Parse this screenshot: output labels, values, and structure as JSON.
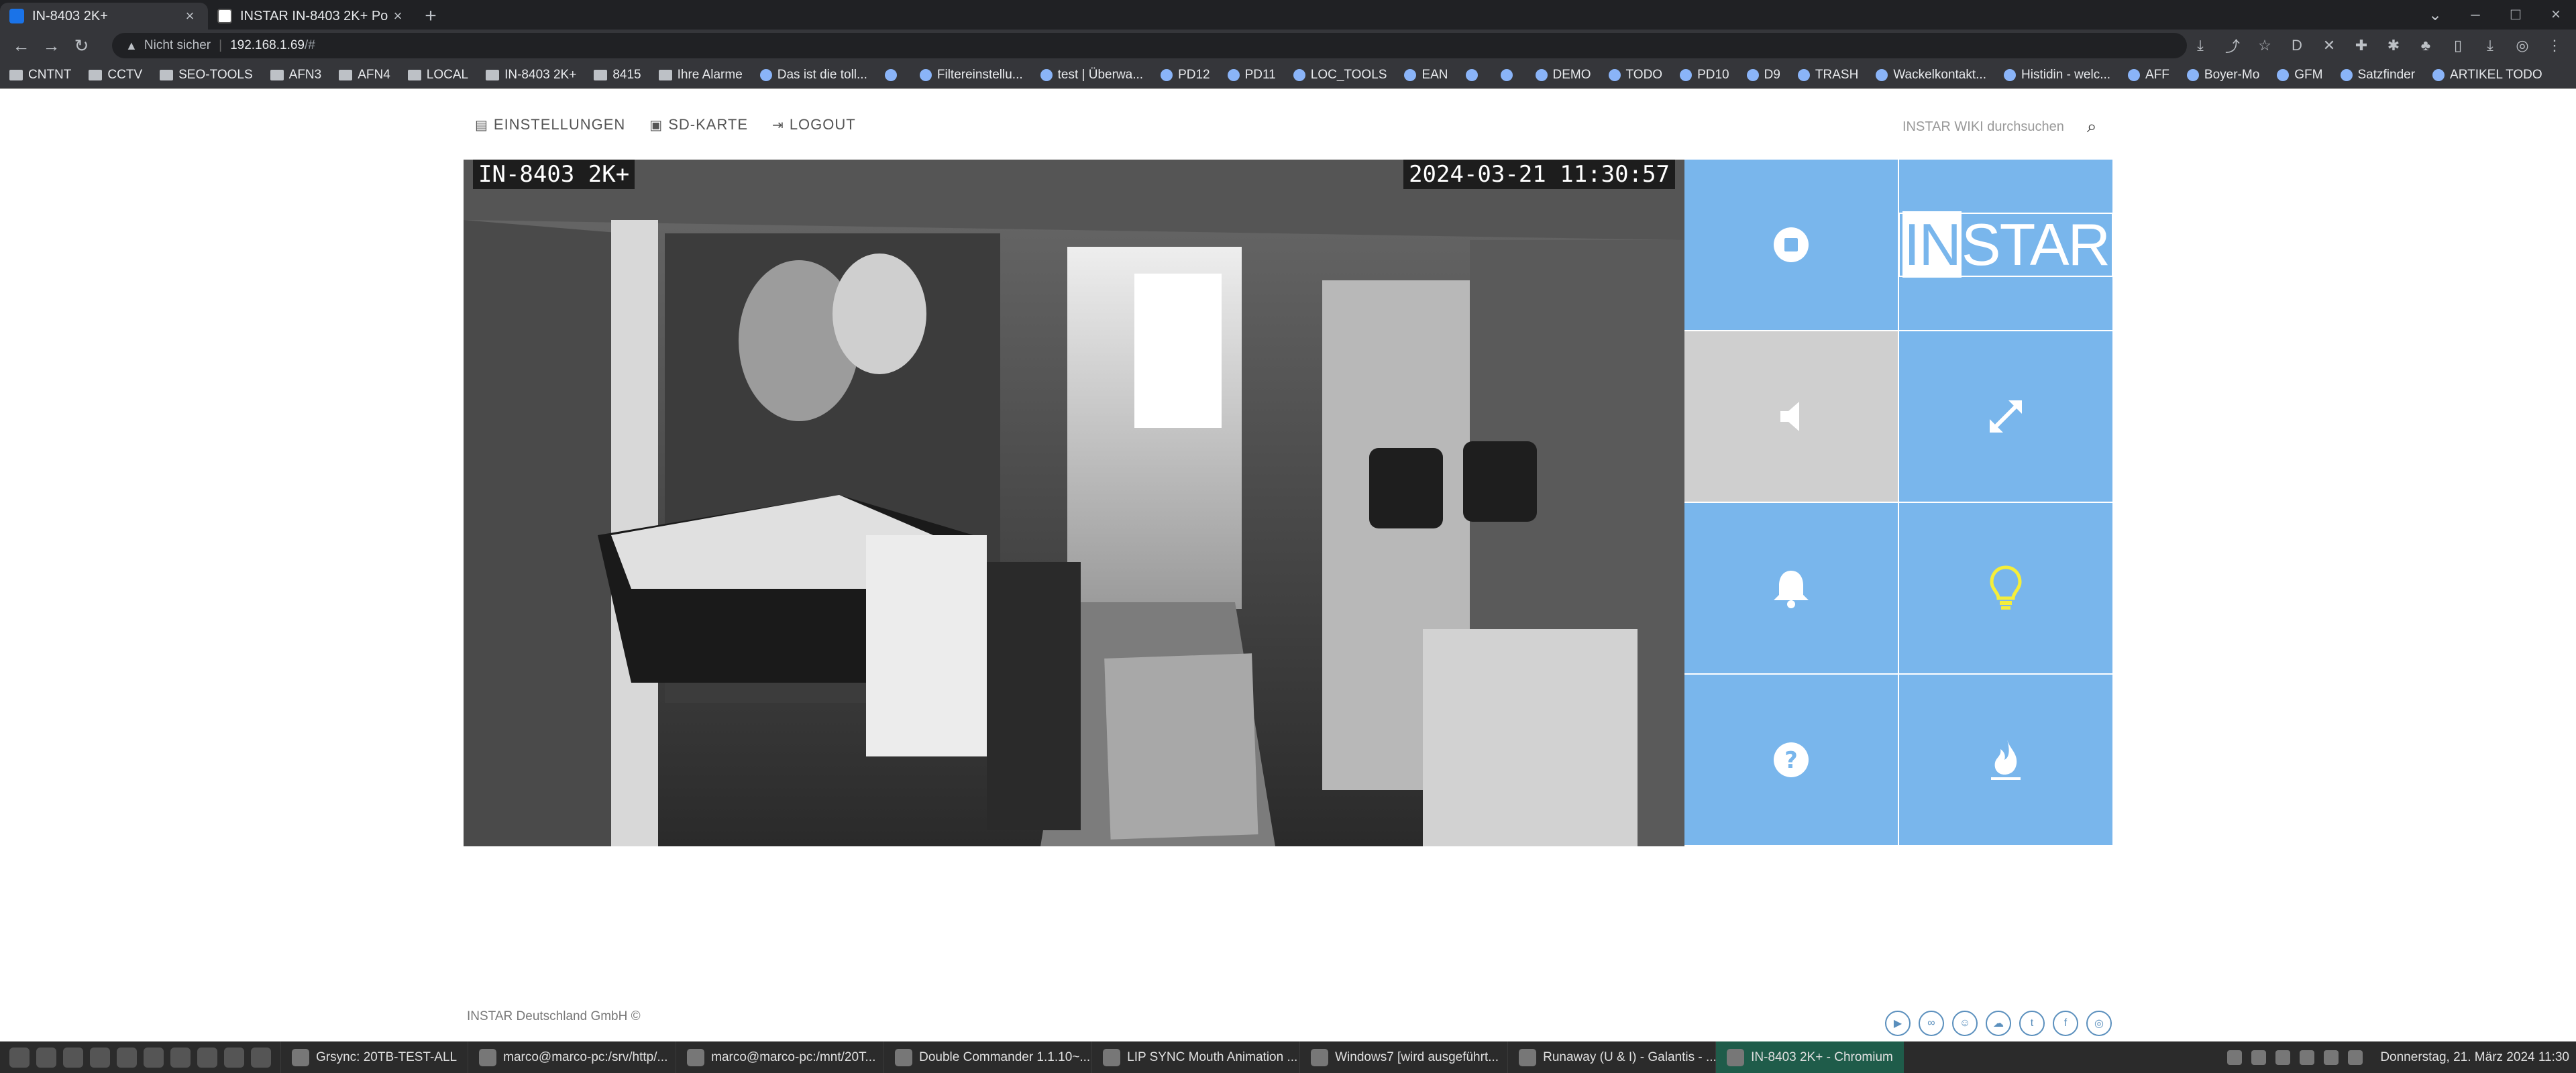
{
  "browser": {
    "tabs": [
      {
        "label": "IN-8403 2K+",
        "active": true
      },
      {
        "label": "INSTAR IN-8403 2K+ Po",
        "active": false
      }
    ],
    "address": {
      "warning": "Nicht sicher",
      "host": "192.168.1.69",
      "path": "/#"
    },
    "bookmarks": [
      "CNTNT",
      "CCTV",
      "SEO-TOOLS",
      "AFN3",
      "AFN4",
      "LOCAL",
      "IN-8403 2K+",
      "8415",
      "Ihre Alarme",
      "Das ist die toll...",
      "",
      "Filtereinstellu...",
      "test | Überwa...",
      "PD12",
      "PD11",
      "LOC_TOOLS",
      "EAN",
      "",
      "",
      "DEMO",
      "TODO",
      "PD10",
      "D9",
      "TRASH",
      "Wackelkontakt...",
      "Histidin - welc...",
      "AFF",
      "Boyer-Mo",
      "GFM",
      "Satzfinder",
      "ARTIKEL TODO"
    ]
  },
  "page": {
    "nav": {
      "settings": "EINSTELLUNGEN",
      "sdcard": "SD-KARTE",
      "logout": "LOGOUT"
    },
    "search_placeholder": "INSTAR WIKI durchsuchen",
    "camera": {
      "name": "IN-8403 2K+",
      "timestamp": "2024-03-21 11:30:57"
    },
    "logo": {
      "highlight": "IN",
      "rest": "STAR"
    },
    "footer": "INSTAR Deutschland GmbH ©",
    "colors": {
      "tile": "#79b6ec",
      "tile_muted": "#cfcfcf",
      "bulb": "#f5ee3a"
    },
    "tiles": [
      "stop-icon",
      "logo",
      "speaker-icon",
      "fullscreen-icon",
      "bell-icon",
      "bulb-icon",
      "help-icon",
      "flame-icon"
    ],
    "social": [
      "youtube-icon",
      "social-icon",
      "social-icon",
      "social-icon",
      "twitter-icon",
      "facebook-icon",
      "instagram-icon"
    ]
  },
  "taskbar": {
    "tasks": [
      {
        "label": "Grsync: 20TB-TEST-ALL",
        "active": false
      },
      {
        "label": "marco@marco-pc:/srv/http/...",
        "active": false
      },
      {
        "label": "marco@marco-pc:/mnt/20T...",
        "active": false
      },
      {
        "label": "Double Commander 1.1.10~...",
        "active": false
      },
      {
        "label": "LIP SYNC Mouth Animation ...",
        "active": false
      },
      {
        "label": "Windows7 [wird ausgeführt...",
        "active": false
      },
      {
        "label": "Runaway (U & I) - Galantis - ...",
        "active": false
      },
      {
        "label": "IN-8403 2K+ - Chromium",
        "active": true
      }
    ],
    "clock": "Donnerstag, 21. März 2024 11:30"
  }
}
